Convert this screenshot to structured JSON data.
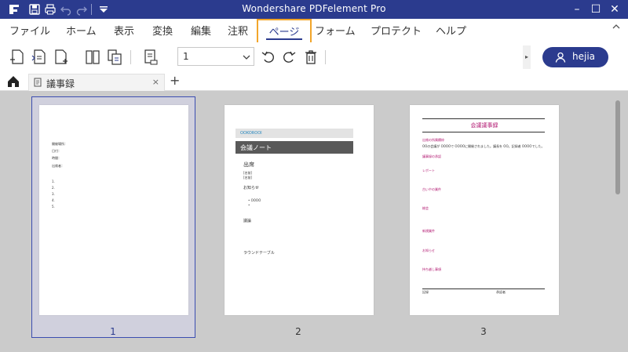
{
  "app": {
    "title": "Wondershare PDFelement Pro"
  },
  "window_controls": [
    "–",
    "☐",
    "✕"
  ],
  "menu": {
    "items": [
      "ファイル",
      "ホーム",
      "表示",
      "変換",
      "編集",
      "注釈",
      "ページ",
      "フォーム",
      "プロテクト",
      "ヘルプ"
    ],
    "active": "ページ"
  },
  "toolbar": {
    "page_select_value": "1",
    "user_label": "hejia"
  },
  "tabs": {
    "document_tab": "議事録",
    "close": "×",
    "add": "+"
  },
  "pages": [
    {
      "number": "1",
      "lines": [
        "開催場所：",
        "日付：",
        "時間：",
        "出席者：",
        "1.",
        "2.",
        "3.",
        "4.",
        "5."
      ]
    },
    {
      "number": "2",
      "header": "OOKOROOI",
      "banner": "会議ノート",
      "section1": "出席",
      "sub1": [
        "[名前]",
        "[名前]"
      ],
      "section2": "お知らせ",
      "bullets": [
        "• OOOO",
        "•"
      ],
      "section3": "議論",
      "section4": "ラウンドテーブル"
    },
    {
      "number": "3",
      "title": "会議議事録",
      "headings": [
        "出席の所属欄枠",
        "議事録の承認",
        "レポート",
        "古いやの業件",
        "総会",
        "新規業件",
        "お知らせ",
        "持ち越し事項"
      ],
      "body": "OOの会議が OOOOで OOOOに開催されました。議長を OO。記録者 OOOOでした。",
      "footer_left": "記録",
      "footer_right": "承認者"
    }
  ],
  "colors": {
    "titlebar": "#2b3b8e",
    "accent": "#2b3b8e",
    "highlight": "#f2a52a",
    "magenta": "#b0136e"
  }
}
